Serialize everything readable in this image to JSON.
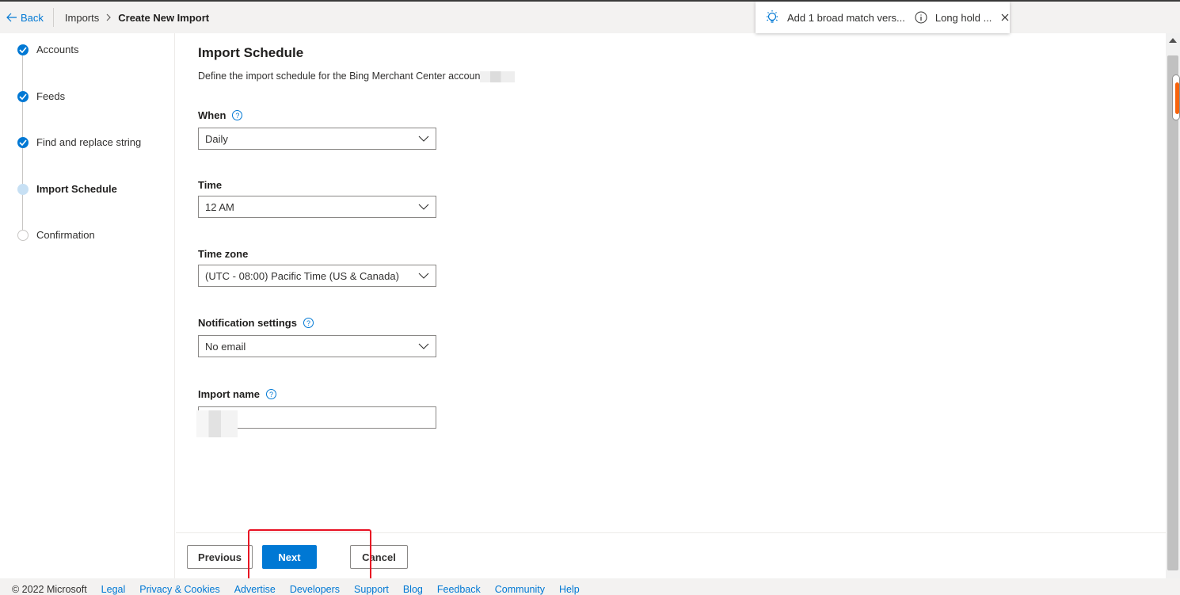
{
  "topbar": {
    "back_label": "Back",
    "breadcrumb_parent": "Imports",
    "breadcrumb_current": "Create New Import"
  },
  "toast": {
    "message": "Add 1 broad match vers...",
    "secondary": "Long hold ..."
  },
  "steps": [
    {
      "label": "Accounts",
      "state": "done"
    },
    {
      "label": "Feeds",
      "state": "done"
    },
    {
      "label": "Find and replace string",
      "state": "done"
    },
    {
      "label": "Import Schedule",
      "state": "current"
    },
    {
      "label": "Confirmation",
      "state": "todo"
    }
  ],
  "form": {
    "title": "Import Schedule",
    "subtitle": "Define the import schedule for the Bing Merchant Center accoun",
    "when_label": "When",
    "when_value": "Daily",
    "time_label": "Time",
    "time_value": "12 AM",
    "timezone_label": "Time zone",
    "timezone_value": "(UTC - 08:00) Pacific Time (US & Canada)",
    "notification_label": "Notification settings",
    "notification_value": "No email",
    "import_name_label": "Import name",
    "help_glyph": "?"
  },
  "actions": {
    "previous": "Previous",
    "next": "Next",
    "cancel": "Cancel"
  },
  "footer": {
    "copyright": "© 2022 Microsoft",
    "links": [
      "Legal",
      "Privacy & Cookies",
      "Advertise",
      "Developers",
      "Support",
      "Blog",
      "Feedback",
      "Community",
      "Help"
    ]
  },
  "colors": {
    "accent": "#0078d4",
    "highlight": "#e81123",
    "step_current": "#c7e0f4"
  },
  "icons": {
    "back": "arrow-left-icon",
    "breadcrumb_separator": "chevron-right-icon",
    "toast_tip": "lightbulb-icon",
    "toast_info": "info-icon",
    "toast_close": "close-icon",
    "select": "chevron-down-icon",
    "help": "help-icon",
    "step_done": "checkmark-icon"
  }
}
